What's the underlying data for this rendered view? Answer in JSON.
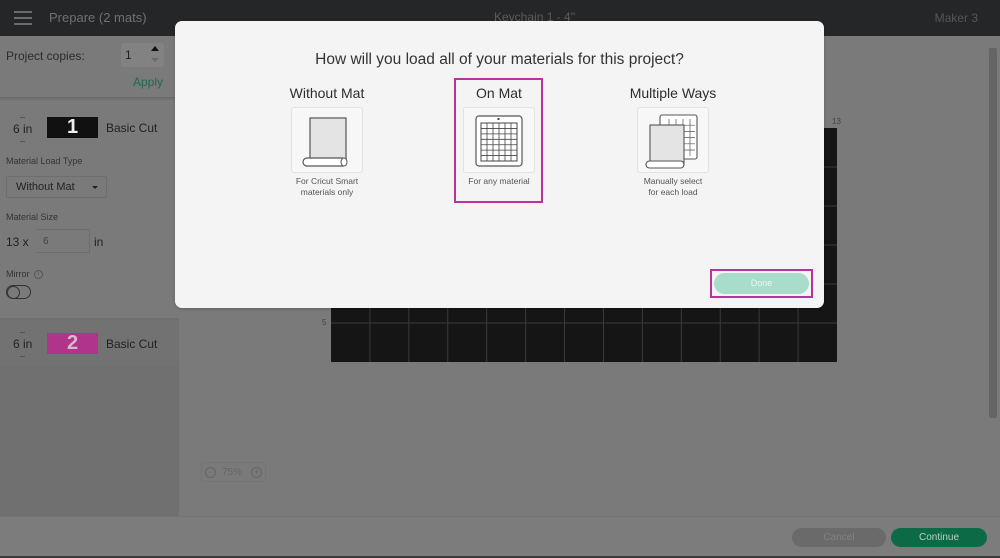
{
  "topbar": {
    "title": "Prepare (2 mats)",
    "project": "Keychain 1 - 4\"",
    "machine": "Maker 3"
  },
  "left_panel": {
    "copies_label": "Project copies:",
    "copies_value": "1",
    "apply_label": "Apply",
    "mats": [
      {
        "size": "6 in",
        "number": "1",
        "cut_type": "Basic Cut",
        "thumb_color": "#111111",
        "load_type_label": "Material Load Type",
        "load_type_value": "Without Mat",
        "material_size_label": "Material Size",
        "width_label": "13 x",
        "length_value": "6",
        "unit": "in",
        "mirror_label": "Mirror",
        "mirror_on": false
      },
      {
        "size": "6 in",
        "number": "2",
        "cut_type": "Basic Cut",
        "thumb_color": "#b0358a"
      }
    ]
  },
  "canvas": {
    "ruler_top_end": "13",
    "ruler_left_mark": "5",
    "zoom_value": "75%",
    "mat_columns": 13,
    "mat_rows": 6
  },
  "footer": {
    "cancel_label": "Cancel",
    "continue_label": "Continue"
  },
  "modal": {
    "title": "How will you load all of your materials for this project?",
    "options": [
      {
        "title": "Without Mat",
        "desc_line1": "For Cricut Smart",
        "desc_line2": "materials only",
        "icon": "roll-material-icon",
        "selected": false
      },
      {
        "title": "On Mat",
        "desc_line1": "For any material",
        "desc_line2": "",
        "icon": "cutting-mat-icon",
        "selected": true
      },
      {
        "title": "Multiple Ways",
        "desc_line1": "Manually select",
        "desc_line2": "for each load",
        "icon": "mixed-load-icon",
        "selected": false
      }
    ],
    "done_label": "Done",
    "highlight_color": "#b8339c",
    "done_color": "#a8dccb"
  }
}
